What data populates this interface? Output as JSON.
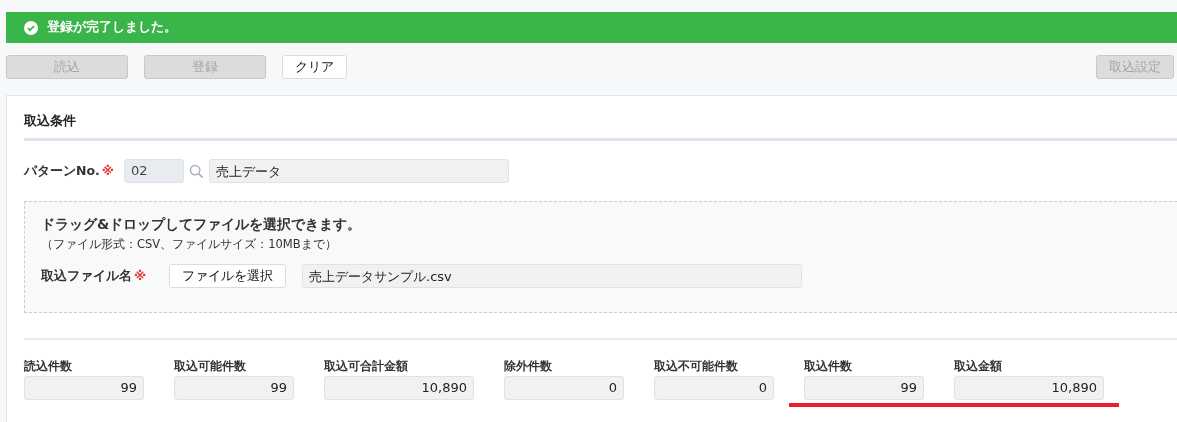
{
  "alert": {
    "kind": "success",
    "message": "登録が完了しました。"
  },
  "toolbar": {
    "buttons": [
      {
        "label": "読込",
        "disabled": true
      },
      {
        "label": "登録",
        "disabled": true
      },
      {
        "label": "クリア",
        "disabled": false
      }
    ],
    "settings_button": {
      "label": "取込設定",
      "disabled": true
    }
  },
  "section": {
    "title": "取込条件",
    "pattern": {
      "label": "パターンNo.",
      "required_mark": "※",
      "code": "02",
      "name": "売上データ"
    },
    "dropzone": {
      "heading": "ドラッグ&ドロップしてファイルを選択できます。",
      "note": "（ファイル形式：CSV、ファイルサイズ：10MBまで）",
      "file_label": "取込ファイル名",
      "required_mark": "※",
      "choose_button": "ファイルを選択",
      "file_name": "売上データサンプル.csv"
    },
    "stats": [
      {
        "label": "読込件数",
        "value": "99",
        "wide": false,
        "highlighted": false
      },
      {
        "label": "取込可能件数",
        "value": "99",
        "wide": false,
        "highlighted": false
      },
      {
        "label": "取込可合計金額",
        "value": "10,890",
        "wide": true,
        "highlighted": false
      },
      {
        "label": "除外件数",
        "value": "0",
        "wide": false,
        "highlighted": false
      },
      {
        "label": "取込不可能件数",
        "value": "0",
        "wide": false,
        "highlighted": false
      },
      {
        "label": "取込件数",
        "value": "99",
        "wide": false,
        "highlighted": true
      },
      {
        "label": "取込金額",
        "value": "10,890",
        "wide": true,
        "highlighted": true
      }
    ]
  }
}
